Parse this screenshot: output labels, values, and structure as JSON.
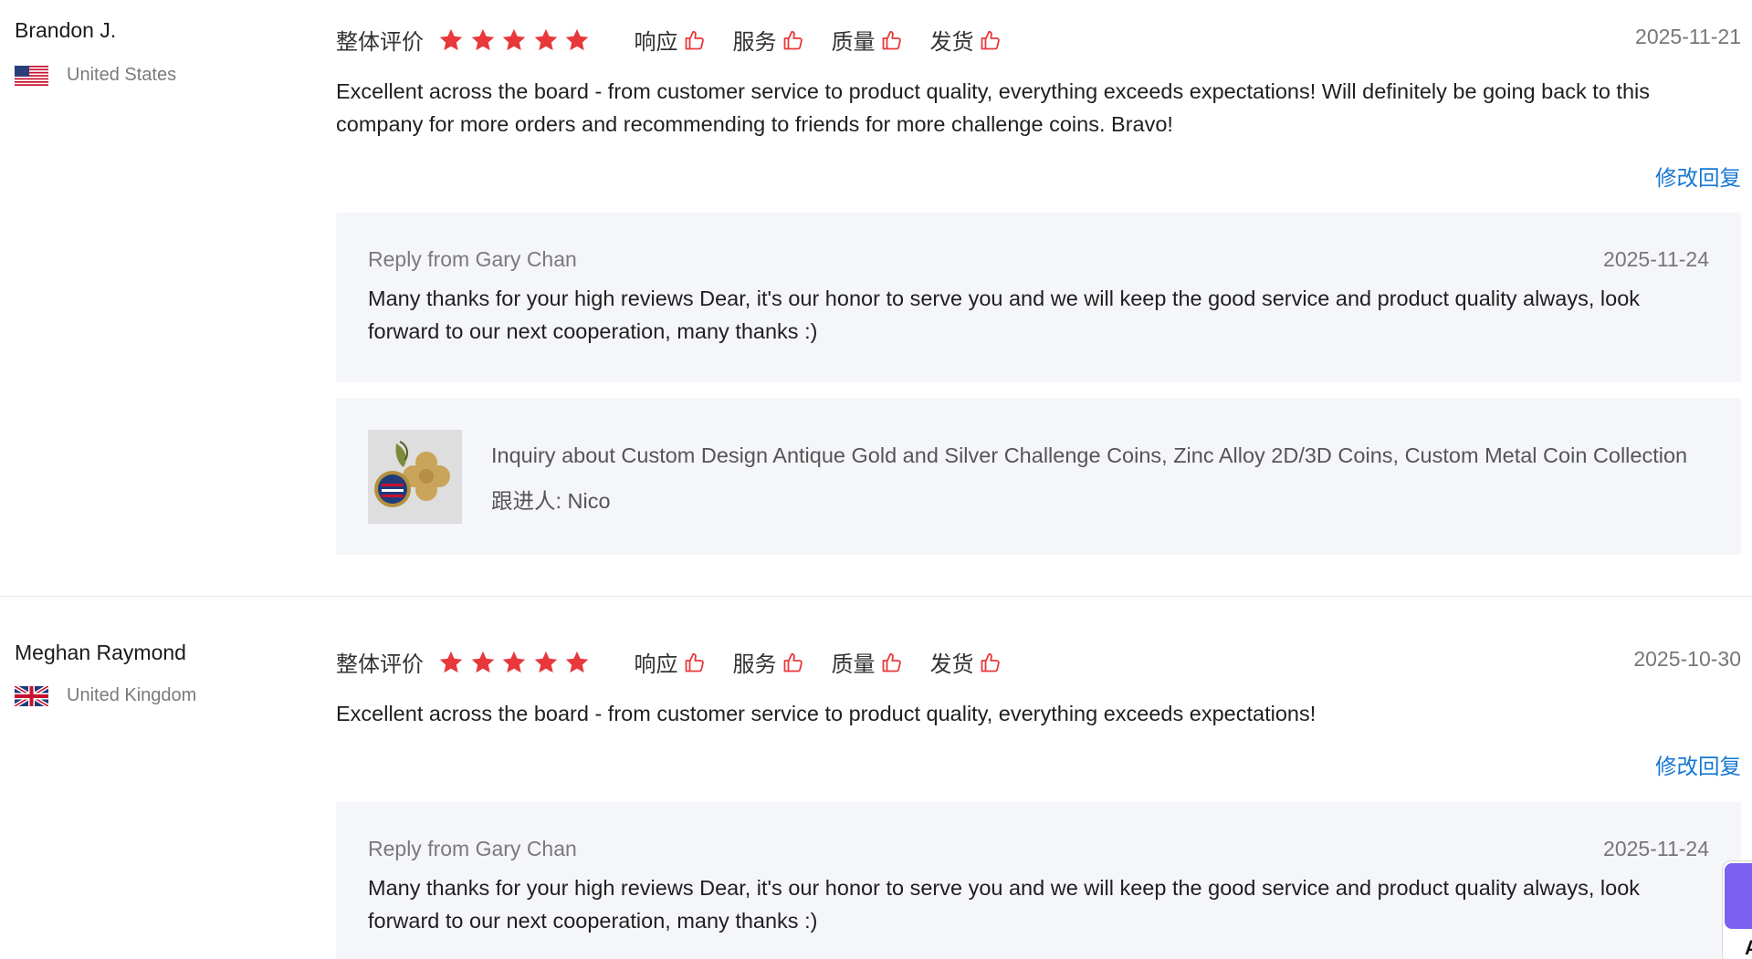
{
  "reviews": [
    {
      "buyer": {
        "name": "Brandon J.",
        "country": "United States",
        "flag_icon": "us-flag-icon"
      },
      "rating": {
        "overall_label": "整体评价",
        "stars": 5,
        "star_color": "#e8383b",
        "aspects": [
          "响应",
          "服务",
          "质量",
          "发货"
        ]
      },
      "date": "2025-11-21",
      "text": "Excellent across the board - from customer service to product quality, everything exceeds expectations! Will definitely be going back to this company for more orders and recommending to friends for more challenge coins. Bravo!",
      "edit_reply_label": "修改回复",
      "reply": {
        "from": "Reply from Gary Chan",
        "date": "2025-11-24",
        "text": "Many thanks for your high reviews Dear, it's our honor to serve you and we will keep the good service and product quality always, look forward to our next cooperation, many thanks :)"
      },
      "product": {
        "title": "Inquiry about Custom Design Antique Gold and Silver Challenge Coins, Zinc Alloy 2D/3D Coins, Custom Metal Coin Collection",
        "follow_up": "跟进人: Nico"
      }
    },
    {
      "buyer": {
        "name": "Meghan Raymond",
        "country": "United Kingdom",
        "flag_icon": "uk-flag-icon"
      },
      "rating": {
        "overall_label": "整体评价",
        "stars": 5,
        "star_color": "#e8383b",
        "aspects": [
          "响应",
          "服务",
          "质量",
          "发货"
        ]
      },
      "date": "2025-10-30",
      "text": "Excellent across the board - from customer service to product quality, everything exceeds expectations!",
      "edit_reply_label": "修改回复",
      "reply": {
        "from": "Reply from Gary Chan",
        "date": "2025-11-24",
        "text": "Many thanks for your high reviews Dear, it's our honor to serve you and we will keep the good service and product quality always, look forward to our next cooperation, many thanks :)"
      }
    }
  ],
  "side_widget": {
    "label": "A",
    "accent": "#7b61f0"
  },
  "colors": {
    "link": "#1677d2",
    "panel": "#f5f6fa",
    "star": "#e8383b"
  }
}
